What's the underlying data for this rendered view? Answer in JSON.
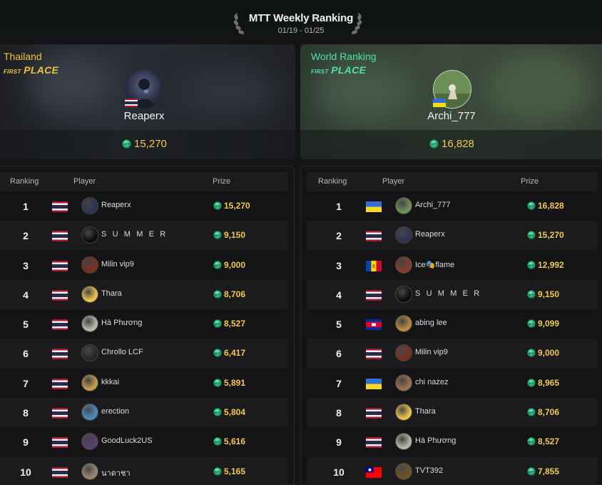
{
  "header": {
    "title": "MTT Weekly Ranking",
    "date_range": "01/19 - 01/25"
  },
  "local_winner": {
    "region": "Thailand",
    "badge_prefix": "FIRST",
    "badge_main": "PLACE",
    "name": "Reaperx",
    "flag": "TH",
    "prize": "15,270"
  },
  "world_winner": {
    "region": "World Ranking",
    "badge_prefix": "FIRST",
    "badge_main": "PLACE",
    "name": "Archi_777",
    "flag": "UA",
    "prize": "16,828"
  },
  "columns": {
    "ranking": "Ranking",
    "player": "Player",
    "prize": "Prize"
  },
  "local_ranking": [
    {
      "rank": "1",
      "flag": "TH",
      "name": "Reaperx",
      "prize": "15,270",
      "avatar_color": "#2b3350"
    },
    {
      "rank": "2",
      "flag": "TH",
      "name": "S U M M E R",
      "prize": "9,150",
      "avatar_color": "#0d0d0d"
    },
    {
      "rank": "3",
      "flag": "TH",
      "name": "Milin vip9",
      "prize": "9,000",
      "avatar_color": "#7a2e1c"
    },
    {
      "rank": "4",
      "flag": "TH",
      "name": "Thara",
      "prize": "8,706",
      "avatar_color": "#e8c24a"
    },
    {
      "rank": "5",
      "flag": "TH",
      "name": "Hà Phương",
      "prize": "8,527",
      "avatar_color": "#b7b7a8"
    },
    {
      "rank": "6",
      "flag": "TH",
      "name": "Chrollo LCF",
      "prize": "6,417",
      "avatar_color": "#2a2422"
    },
    {
      "rank": "7",
      "flag": "TH",
      "name": "kkkai",
      "prize": "5,891",
      "avatar_color": "#c49a4e"
    },
    {
      "rank": "8",
      "flag": "TH",
      "name": "erection",
      "prize": "5,804",
      "avatar_color": "#4e88b8"
    },
    {
      "rank": "9",
      "flag": "TH",
      "name": "GoodLuck2US",
      "prize": "5,616",
      "avatar_color": "#5c3e6e"
    },
    {
      "rank": "10",
      "flag": "TH",
      "name": "นาดาชา",
      "prize": "5,165",
      "avatar_color": "#9a8670"
    }
  ],
  "world_ranking": [
    {
      "rank": "1",
      "flag": "UA",
      "name": "Archi_777",
      "prize": "16,828",
      "avatar_color": "#6e9058"
    },
    {
      "rank": "2",
      "flag": "TH",
      "name": "Reaperx",
      "prize": "15,270",
      "avatar_color": "#2b3350"
    },
    {
      "rank": "3",
      "flag": "MD",
      "name": "Ice🎭flame",
      "prize": "12,992",
      "avatar_color": "#8a3b2a"
    },
    {
      "rank": "4",
      "flag": "TH",
      "name": "S U M M E R",
      "prize": "9,150",
      "avatar_color": "#0d0d0d"
    },
    {
      "rank": "5",
      "flag": "KH",
      "name": "abing lee",
      "prize": "9,099",
      "avatar_color": "#b8893c"
    },
    {
      "rank": "6",
      "flag": "TH",
      "name": "Milin vip9",
      "prize": "9,000",
      "avatar_color": "#7a2e1c"
    },
    {
      "rank": "7",
      "flag": "UA",
      "name": "chi nazez",
      "prize": "8,965",
      "avatar_color": "#a0704c"
    },
    {
      "rank": "8",
      "flag": "TH",
      "name": "Thara",
      "prize": "8,706",
      "avatar_color": "#e8c24a"
    },
    {
      "rank": "9",
      "flag": "TH",
      "name": "Hà Phương",
      "prize": "8,527",
      "avatar_color": "#b7b7a8"
    },
    {
      "rank": "10",
      "flag": "TW",
      "name": "TVT392",
      "prize": "7,855",
      "avatar_color": "#6e5420"
    }
  ],
  "colors": {
    "gold": "#f2c94c",
    "local_accent": "#f0c43a",
    "world_accent": "#4fe0a6",
    "coin": "#2bbf80"
  }
}
